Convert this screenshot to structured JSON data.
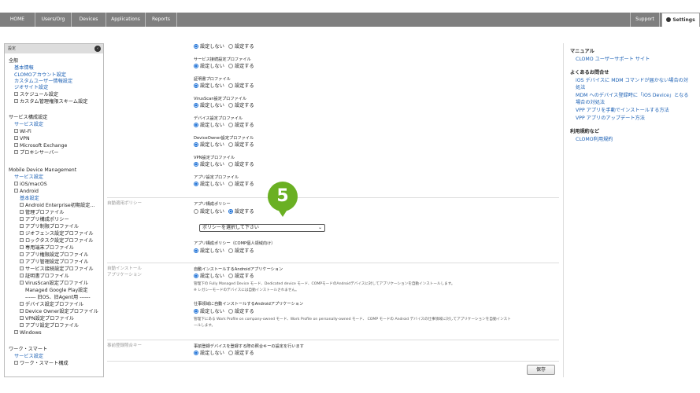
{
  "nav": {
    "tabs": [
      "HOME",
      "Users/Org",
      "Devices",
      "Applications",
      "Reports"
    ],
    "support": "Support",
    "settings": "Settings"
  },
  "sidebar": {
    "title": "設定",
    "general": {
      "heading": "全般",
      "links": [
        "基本情報",
        "CLOMOアカウント設定",
        "カスタムユーザー情報設定",
        "ジオサイト設定"
      ],
      "items": [
        "スケジュール設定",
        "カスタム管理権限スキーム設定"
      ]
    },
    "service": {
      "heading": "サービス構成設定",
      "link": "サービス設定",
      "items": [
        "Wi-Fi",
        "VPN",
        "Microsoft Exchange",
        "プロキシサーバー"
      ]
    },
    "mdm": {
      "heading": "Mobile Device Management",
      "link": "サービス設定",
      "items": [
        "iOS/macOS",
        "Android"
      ],
      "sublink": "基本設定",
      "android_items": [
        "Android Enterprise初期設定...",
        "管理プロファイル",
        "アプリ構成ポリシー",
        "アプリ制限プロファイル",
        "ジオフェンス設定プロファイル",
        "ロックタスク設定プロファイル",
        "専用端末プロファイル",
        "アプリ権限設定プロファイル",
        "アプリ管理設定プロファイル",
        "サービス接続設定プロファイル",
        "証明書プロファイル",
        "VirusScan設定プロファイル",
        "Managed Google Play設定",
        "------ 旧OS、旧Agent用 ------",
        "デバイス設定プロファイル",
        "Device Owner設定プロファイル",
        "VPN設定プロファイル",
        "アプリ設定プロファイル"
      ],
      "windows": "Windows"
    },
    "work": {
      "heading": "ワーク・スマート",
      "link": "サービス設定",
      "item": "ワーク・スマート構成"
    }
  },
  "main": {
    "radio_off": "設定しない",
    "radio_on": "設定する",
    "top_profiles": [
      "サービス接続設定プロファイル",
      "証明書プロファイル",
      "VirusScan設定プロファイル",
      "デバイス設定プロファイル",
      "DeviceOwner設定プロファイル",
      "VPN設定プロファイル",
      "アプリ設定プロファイル"
    ],
    "auto_policy": {
      "section": "自動適用ポリシー",
      "label": "アプリ構成ポリシー",
      "select": "ポリシーを選択して下さい",
      "label2": "アプリ構成ポリシー（COMP個人領域向け）"
    },
    "auto_install": {
      "section_line1": "自動インストール",
      "section_line2": "アプリケーション",
      "label1": "自動インストールするAndroidアプリケーション",
      "note1a": "管理下の Fully Managed Device モード、Dedicated device モード、COMPモードのAndroidデバイスに対してアプリケーションを自動インストールします。",
      "note1b": "※ レガシーモードのデバイスには自動インストールされません。",
      "label2": "仕事領域に自動インストールするAndroidアプリケーション",
      "note2a": "管理下にある Work Profile on company-owned モード、Work Profile on personally-owned モード、 COMP モードの Android デバイスの仕事領域に対してアプリケーションを自動インスト",
      "note2b": "ールします。"
    },
    "prereg": {
      "section": "事前登録照合キー",
      "label": "事前登録デバイスを登録する際の照合キーの設定を行います"
    },
    "save": "保存",
    "step_badge": "5"
  },
  "help": {
    "manual_heading": "マニュアル",
    "manual_link": "CLOMO ユーザーサポート サイト",
    "faq_heading": "よくあるお問合せ",
    "faq_links": [
      "iOS デバイスに MDM コマンドが届かない場合の対",
      "処法",
      "MDM へのデバイス登録時に「iOS Device」となる",
      "場合の対処法",
      "VPP アプリを手動でインストールする方法",
      "VPP アプリのアップデート方法"
    ],
    "terms_heading": "利用規約など",
    "terms_link": "CLOMO利用規約"
  }
}
